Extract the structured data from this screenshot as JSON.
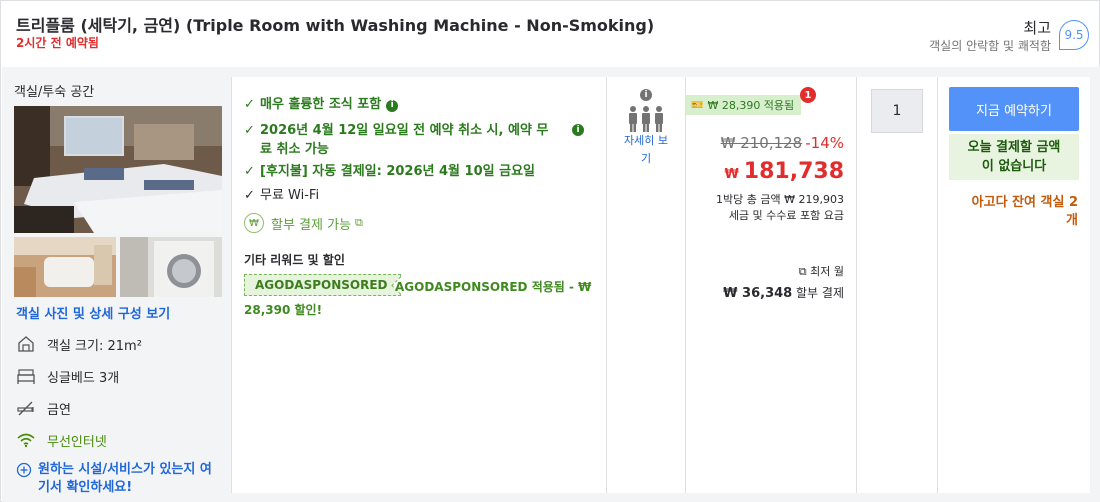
{
  "header": {
    "room_title": "트리플룸 (세탁기, 금연) (Triple Room with Washing Machine - Non-Smoking)",
    "booked_ago": "2시간 전 예약됨",
    "rating_word": "최고",
    "rating_desc": "객실의 안락함 및 쾌적함",
    "rating_score": "9.5"
  },
  "room": {
    "section_title": "객실/투숙 공간",
    "photos_link": "객실 사진 및 상세 구성 보기",
    "facilities": [
      {
        "icon": "room-size-icon",
        "label": "객실 크기: 21m²"
      },
      {
        "icon": "bed-icon",
        "label": "싱글베드 3개"
      },
      {
        "icon": "no-smoking-icon",
        "label": "금연"
      },
      {
        "icon": "wifi-icon",
        "label": "무선인터넷"
      }
    ],
    "more_facilities": "원하는 시설/서비스가 있는지 여기서 확인하세요!"
  },
  "benefits": {
    "items": [
      "매우 훌륭한 조식 포함",
      "2026년 4월 12일 일요일 전 예약 취소 시, 예약 무료 취소 가능",
      "[후지불] 자동 결제일: 2026년 4월 10일 금요일",
      "무료 Wi-Fi"
    ],
    "split_payment": "할부 결제 가능",
    "other_head": "기타 리워드 및 할인",
    "coupon_code": "AGODASPONSORED",
    "coupon_text_1": "AGODASPONSORED 적용됨 - ₩",
    "coupon_text_2": "28,390 할인!"
  },
  "occupancy": {
    "detail_label_1": "자세히 보",
    "detail_label_2": "기"
  },
  "price": {
    "applied": "₩ 28,390 적용됨",
    "notif_count": "1",
    "original": "₩ 210,128",
    "discount": "-14%",
    "currency": "₩",
    "final": "181,738",
    "total_line": "1박당 총 금액 ₩ 219,903",
    "tax_line": "세금 및 수수료 포함 요금",
    "monthly_low": "최저 월",
    "monthly_amount": "₩ 36,348",
    "monthly_suffix": " 할부 결제"
  },
  "quantity": {
    "value": "1"
  },
  "cta": {
    "book_label": "지금 예약하기",
    "pay_now_1": "오늘 결제할 금액",
    "pay_now_2": "이 없습니다",
    "rooms_left_1": "아고다 잔여 객실 2",
    "rooms_left_2": "개"
  },
  "colors": {
    "accent_blue": "#5392f9",
    "link_blue": "#2067da",
    "benefit_green": "#2b7a1e",
    "price_red": "#e12d2d",
    "urgency_orange": "#c25b0b"
  }
}
